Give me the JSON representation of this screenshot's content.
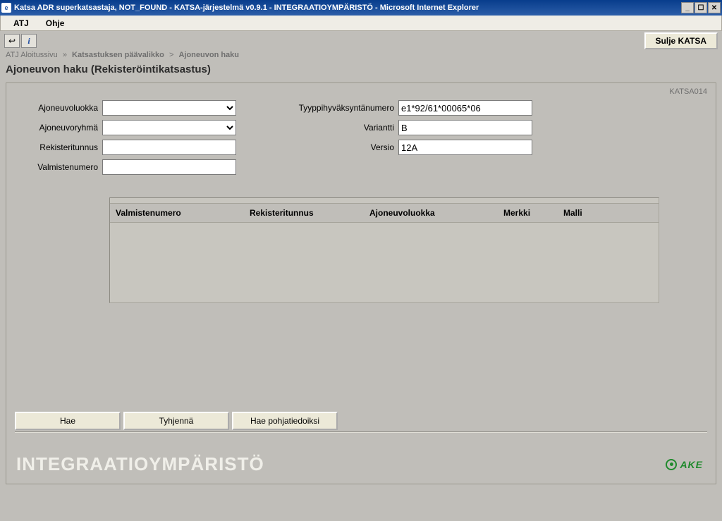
{
  "window": {
    "title": "Katsa ADR superkatsastaja, NOT_FOUND - KATSA-järjestelmä v0.9.1 - INTEGRAATIOYMPÄRISTÖ - Microsoft Internet Explorer"
  },
  "menubar": {
    "atj": "ATJ",
    "ohje": "Ohje"
  },
  "toolbar": {
    "back_glyph": "↩",
    "info_glyph": "i",
    "close_label": "Sulje KATSA"
  },
  "breadcrumb": {
    "items": [
      "ATJ Aloitussivu",
      "Katsastuksen päävalikko",
      "Ajoneuvon haku"
    ],
    "sep": "»",
    "sep2": ">"
  },
  "page": {
    "title": "Ajoneuvon haku (Rekisteröintikatsastus)",
    "screen_id": "KATSA014"
  },
  "form": {
    "left": {
      "ajoneuvoluokka_label": "Ajoneuvoluokka",
      "ajoneuvoryhma_label": "Ajoneuvoryhmä",
      "rekisteritunnus_label": "Rekisteritunnus",
      "valmistenumero_label": "Valmistenumero",
      "ajoneuvoluokka_value": "",
      "ajoneuvoryhma_value": "",
      "rekisteritunnus_value": "",
      "valmistenumero_value": ""
    },
    "right": {
      "tyyppi_label": "Tyyppihyväksyntänumero",
      "variantti_label": "Variantti",
      "versio_label": "Versio",
      "tyyppi_value": "e1*92/61*00065*06",
      "variantti_value": "B",
      "versio_value": "12A"
    }
  },
  "results": {
    "headers": {
      "valmistenumero": "Valmistenumero",
      "rekisteritunnus": "Rekisteritunnus",
      "ajoneuvoluokka": "Ajoneuvoluokka",
      "merkki": "Merkki",
      "malli": "Malli"
    },
    "rows": []
  },
  "actions": {
    "hae": "Hae",
    "tyhjenna": "Tyhjennä",
    "pohjatiedoiksi": "Hae pohjatiedoiksi"
  },
  "banner": {
    "env": "INTEGRAATIOYMPÄRISTÖ",
    "brand": "AKE"
  }
}
